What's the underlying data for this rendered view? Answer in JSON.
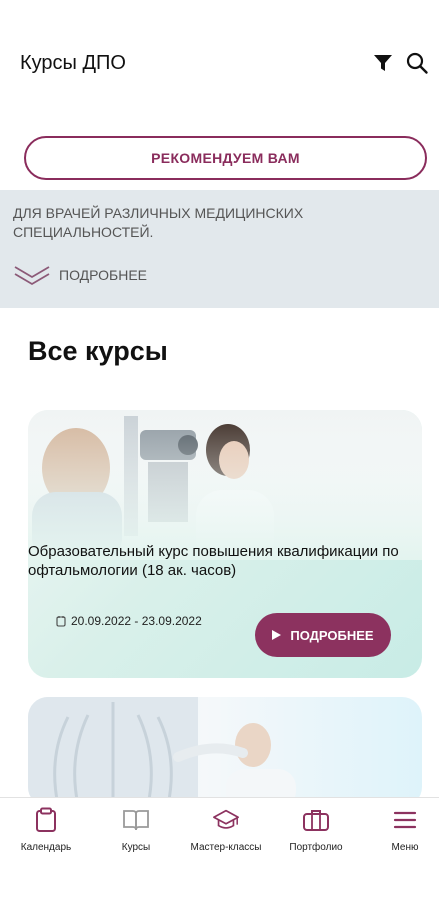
{
  "header": {
    "title": "Курсы ДПО",
    "filter_icon": "filter-icon",
    "search_icon": "search-icon"
  },
  "recommend_button": {
    "label": "РЕКОМЕНДУЕМ ВАМ"
  },
  "info_panel": {
    "text": "ДЛЯ ВРАЧЕЙ РАЗЛИЧНЫХ МЕДИЦИНСКИХ СПЕЦИАЛЬНОСТЕЙ.",
    "more_label": "ПОДРОБНЕЕ"
  },
  "section": {
    "title": "Все курсы"
  },
  "courses": [
    {
      "title": "Образовательный курс повышения квалификации по офтальмологии (18 ак. часов)",
      "dates": "20.09.2022 - 23.09.2022",
      "more_label": "ПОДРОБНЕЕ"
    }
  ],
  "bottom_nav": [
    {
      "label": "Календарь",
      "icon": "calendar-icon",
      "active": true
    },
    {
      "label": "Курсы",
      "icon": "book-icon",
      "active": false
    },
    {
      "label": "Мастер-классы",
      "icon": "graduation-cap-icon",
      "active": true
    },
    {
      "label": "Портфолио",
      "icon": "briefcase-icon",
      "active": true
    },
    {
      "label": "Меню",
      "icon": "menu-icon",
      "active": true
    }
  ],
  "colors": {
    "accent": "#8c325f",
    "panel_bg": "#e2e8ec",
    "inactive_icon": "#9a9a9a"
  }
}
